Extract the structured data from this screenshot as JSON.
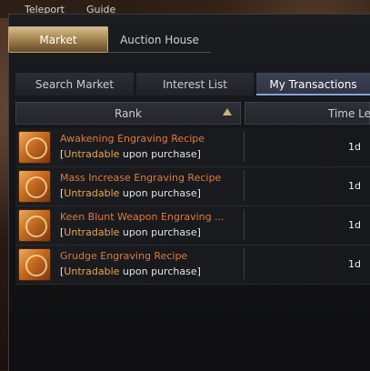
{
  "topbar": {
    "teleport": "Teleport",
    "guide": "Guide"
  },
  "tabs": {
    "market": "Market",
    "auction_house": "Auction House"
  },
  "subtabs": {
    "search": "Search Market",
    "interest": "Interest List",
    "transactions": "My Transactions"
  },
  "table": {
    "headers": {
      "rank": "Rank",
      "time_left": "Time Left"
    },
    "rows": [
      {
        "name": "Awakening Engraving Recipe",
        "note_prefix": "[",
        "note_highlight": "Untradable",
        "note_suffix": " upon purchase]",
        "time": "1d"
      },
      {
        "name": "Mass Increase Engraving Recipe",
        "note_prefix": "[",
        "note_highlight": "Untradable",
        "note_suffix": " upon purchase]",
        "time": "1d"
      },
      {
        "name": "Keen Blunt Weapon Engraving ...",
        "note_prefix": "[",
        "note_highlight": "Untradable",
        "note_suffix": " upon purchase]",
        "time": "1d"
      },
      {
        "name": "Grudge Engraving Recipe",
        "note_prefix": "[",
        "note_highlight": "Untradable",
        "note_suffix": " upon purchase]",
        "time": "1d"
      }
    ]
  },
  "colors": {
    "accent_gold": "#c6a570",
    "item_name": "#e07a3a",
    "untradable": "#e9a74a"
  },
  "icons": {
    "item": "engraving-recipe-book-icon",
    "sort": "sort-ascending-icon"
  }
}
